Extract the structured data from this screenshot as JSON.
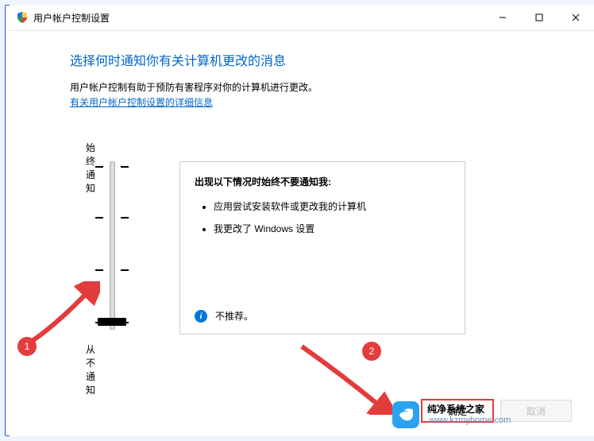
{
  "window": {
    "title": "用户帐户控制设置"
  },
  "content": {
    "heading": "选择何时通知你有关计算机更改的消息",
    "subtext": "用户帐户控制有助于预防有害程序对你的计算机进行更改。",
    "help_link": "有关用户帐户控制设置的详细信息"
  },
  "slider": {
    "top_label": "始终通知",
    "bottom_label": "从不通知",
    "levels": 4,
    "current_level_index": 3
  },
  "info_panel": {
    "title": "出现以下情况时始终不要通知我:",
    "bullets": [
      "应用尝试安装软件或更改我的计算机",
      "我更改了 Windows 设置"
    ],
    "recommendation": "不推荐。"
  },
  "footer": {
    "ok_label": "确定",
    "cancel_label": "取消"
  },
  "annotations": {
    "badge_1": "1",
    "badge_2": "2"
  },
  "watermark": {
    "brand": "纯净系统之家",
    "url": "www.kzmyhome.com"
  }
}
